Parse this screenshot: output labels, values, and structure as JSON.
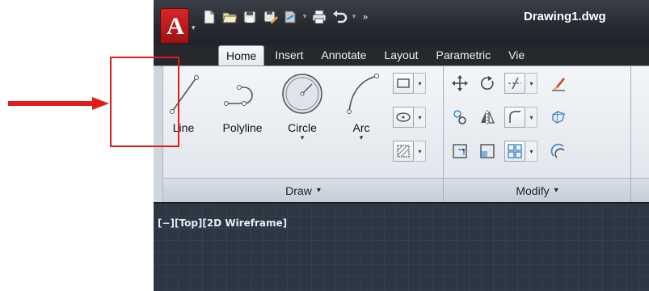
{
  "document": {
    "title": "Drawing1.dwg"
  },
  "app_button": {
    "letter": "A",
    "dropdown": "▾"
  },
  "quick_access": {
    "more_glyph": "»"
  },
  "tabs": [
    {
      "label": "Home",
      "active": true
    },
    {
      "label": "Insert"
    },
    {
      "label": "Annotate"
    },
    {
      "label": "Layout"
    },
    {
      "label": "Parametric"
    },
    {
      "label": "Vie"
    }
  ],
  "ribbon": {
    "draw_panel": {
      "title": "Draw",
      "tools": [
        {
          "label": "Line",
          "icon": "line-icon"
        },
        {
          "label": "Polyline",
          "icon": "polyline-icon"
        },
        {
          "label": "Circle",
          "icon": "circle-icon",
          "has_dropdown": true
        },
        {
          "label": "Arc",
          "icon": "arc-icon",
          "has_dropdown": true
        }
      ],
      "small_tools": [
        "rectangle-icon",
        "ellipse-icon",
        "hatch-icon"
      ]
    },
    "modify_panel": {
      "title": "Modify",
      "tools": [
        "move-icon",
        "rotate-icon",
        "trim-icon",
        "erase-icon",
        "copy-icon",
        "mirror-icon",
        "fillet-icon",
        "explode-icon",
        "stretch-icon",
        "scale-icon",
        "array-icon",
        "offset-icon"
      ]
    },
    "caret": "▾"
  },
  "viewport": {
    "controls_label": "[−][Top][2D Wireframe]"
  },
  "colors": {
    "highlight": "#e31b1b",
    "arrow": "#e31b1b",
    "titlebar": "#272b31",
    "viewport": "#2d3643",
    "app_logo": "#c9191d"
  }
}
